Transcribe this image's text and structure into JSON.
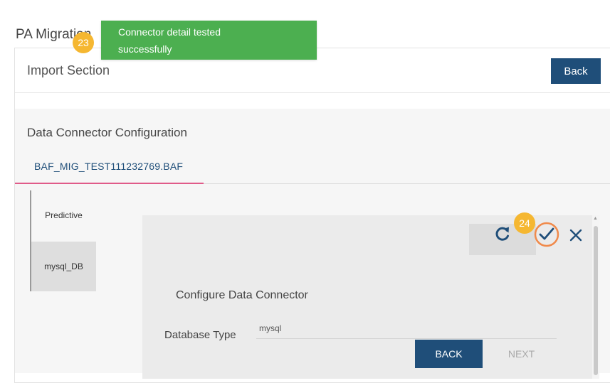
{
  "page": {
    "title": "PA Migration"
  },
  "import_section": {
    "title": "Import Section",
    "back_label": "Back"
  },
  "data_connector": {
    "title": "Data Connector Configuration",
    "active_tab": "BAF_MIG_TEST111232769.BAF"
  },
  "side_list": {
    "items": [
      {
        "label": "Predictive"
      },
      {
        "label": "mysql_DB"
      }
    ]
  },
  "dialog": {
    "title": "Configure Data Connector",
    "database_type_label": "Database Type",
    "database_type_value": "mysql",
    "back_label": "BACK",
    "next_label": "NEXT",
    "icons": [
      "refresh-icon",
      "check-icon",
      "close-icon"
    ]
  },
  "toast": {
    "line1": "Connector detail tested",
    "line2": "successfully"
  },
  "badges": {
    "first": "23",
    "second": "24"
  },
  "colors": {
    "primary": "#1f4e79",
    "toast": "#4caf50",
    "badge": "#f5b731",
    "tab_underline": "#e05b89",
    "check_highlight": "#f08a4b"
  }
}
